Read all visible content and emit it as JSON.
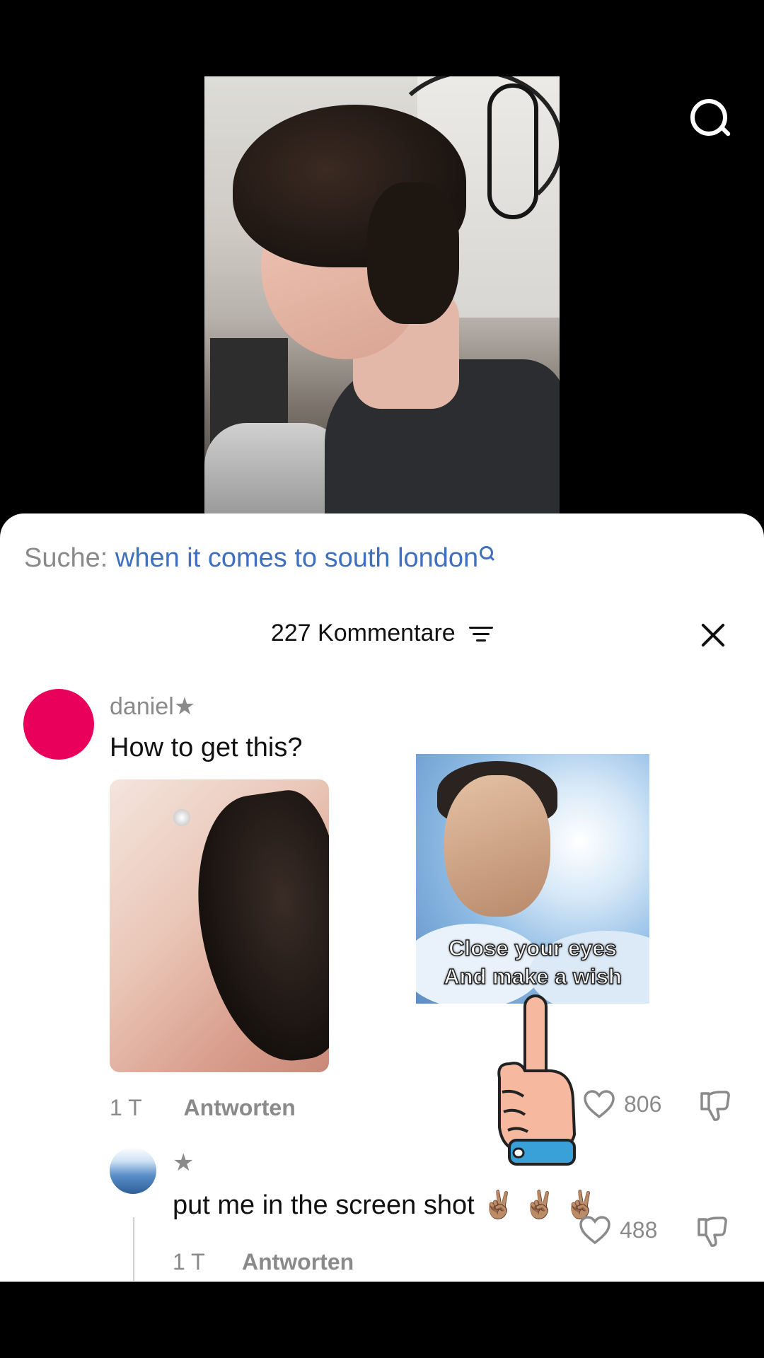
{
  "search": {
    "prefix": "Suche:",
    "query": "when it comes to south london"
  },
  "comments": {
    "title": "227 Kommentare"
  },
  "comment": {
    "username": "daniel★",
    "text": "How to get this?",
    "time": "1 T",
    "reply_label": "Antworten",
    "likes": "806",
    "sticker_text": [
      "Close your eyes",
      "And make a wish"
    ]
  },
  "reply": {
    "username": "★",
    "text": "put me in the screen shot ✌🏽 ✌🏽 ✌🏽",
    "time": "1 T",
    "reply_label": "Antworten",
    "likes": "488"
  },
  "icons": {
    "search": "search-icon",
    "filter": "filter-icon",
    "close": "close-icon",
    "like": "heart-icon",
    "dislike": "thumbs-down-icon"
  }
}
